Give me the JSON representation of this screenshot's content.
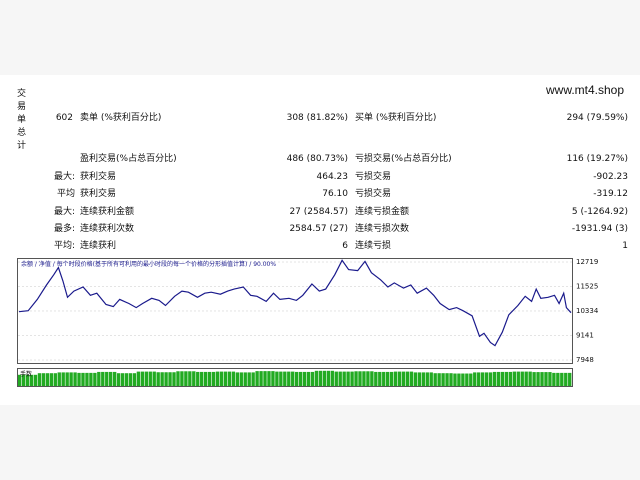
{
  "site": "www.mt4.shop",
  "summary": {
    "side_label": [
      "交",
      "易",
      "单",
      "总",
      "计"
    ],
    "total": "602",
    "sell_label": "卖单 (%获利百分比)",
    "sell_value": "308 (81.82%)",
    "buy_label": "买单 (%获利百分比)",
    "buy_value": "294 (79.59%)",
    "profit_trades_label": "盈利交易(%占总百分比)",
    "profit_trades_value": "486 (80.73%)",
    "loss_trades_label": "亏损交易(%占总百分比)",
    "loss_trades_value": "116 (19.27%)",
    "rows": [
      {
        "prefix": "最大:",
        "label1": "获利交易",
        "value1": "464.23",
        "label2": "亏损交易",
        "value2": "-902.23"
      },
      {
        "prefix": "平均",
        "label1": "获利交易",
        "value1": "76.10",
        "label2": "亏损交易",
        "value2": "-319.12"
      },
      {
        "prefix": "最大:",
        "label1": "连续获利金额",
        "value1": "27 (2584.57)",
        "label2": "连续亏损金额",
        "value2": "5 (-1264.92)"
      },
      {
        "prefix": "最多:",
        "label1": "连续获利次数",
        "value1": "2584.57 (27)",
        "label2": "连续亏损次数",
        "value2": "-1931.94 (3)"
      },
      {
        "prefix": "平均:",
        "label1": "连续获利",
        "value1": "6",
        "label2": "连续亏损",
        "value2": "1"
      }
    ]
  },
  "chart_data": {
    "type": "line",
    "legend_text": "余额 / 净值 / 每个时段价格(基于所有可利用的最小时段的每一个价格的分形插值计算) / 90.00%",
    "legend_items": [
      "余额",
      "净值"
    ],
    "volume_label": "手数",
    "colors": {
      "line": "#1a1a8c",
      "volume": "#22aa22",
      "grid": "#c8c8c8"
    },
    "y_ticks": [
      12719,
      11525,
      10334,
      9141,
      7948
    ],
    "ylim": [
      7948,
      12719
    ],
    "x_ticks": [
      0,
      28,
      53,
      78,
      103,
      128,
      153,
      178,
      203,
      228,
      253,
      278,
      303,
      328,
      353,
      378,
      403,
      428,
      453,
      478,
      503,
      528,
      553,
      578,
      603
    ],
    "xlim": [
      0,
      603
    ],
    "x": [
      0,
      10,
      20,
      30,
      38,
      43,
      48,
      53,
      60,
      70,
      78,
      85,
      95,
      103,
      110,
      120,
      128,
      135,
      145,
      153,
      160,
      170,
      178,
      185,
      195,
      203,
      210,
      220,
      228,
      235,
      245,
      253,
      260,
      270,
      278,
      285,
      295,
      303,
      310,
      320,
      328,
      335,
      345,
      353,
      360,
      370,
      378,
      385,
      395,
      403,
      410,
      420,
      428,
      435,
      445,
      453,
      460,
      470,
      478,
      485,
      495,
      503,
      508,
      515,
      520,
      528,
      535,
      545,
      553,
      560,
      565,
      570,
      578,
      585,
      590,
      595,
      598,
      603
    ],
    "y": [
      10300,
      10350,
      10900,
      11600,
      12100,
      12450,
      11800,
      11000,
      11300,
      11500,
      11100,
      11200,
      10650,
      10550,
      10900,
      10700,
      10500,
      10700,
      10950,
      10850,
      10600,
      11050,
      11300,
      11250,
      11000,
      11200,
      11250,
      11150,
      11300,
      11400,
      11500,
      11100,
      11050,
      10800,
      11200,
      10900,
      10950,
      10850,
      11100,
      11650,
      11300,
      11400,
      12100,
      12800,
      12350,
      12300,
      12750,
      12200,
      11850,
      11500,
      11700,
      11450,
      11600,
      11200,
      11450,
      11100,
      10700,
      10400,
      10500,
      10350,
      10100,
      9100,
      9250,
      8800,
      8650,
      9300,
      10150,
      10600,
      11050,
      10800,
      11400,
      10950,
      11000,
      11100,
      10700,
      11200,
      10500,
      10250
    ],
    "volume_levels": [
      0.7,
      0.8,
      0.85,
      0.82,
      0.88,
      0.8,
      0.9,
      0.86,
      0.92,
      0.88,
      0.9,
      0.85,
      0.93,
      0.9,
      0.88,
      0.95,
      0.9,
      0.92,
      0.88,
      0.9,
      0.85,
      0.8,
      0.78,
      0.85,
      0.88,
      0.9,
      0.87,
      0.82
    ]
  }
}
